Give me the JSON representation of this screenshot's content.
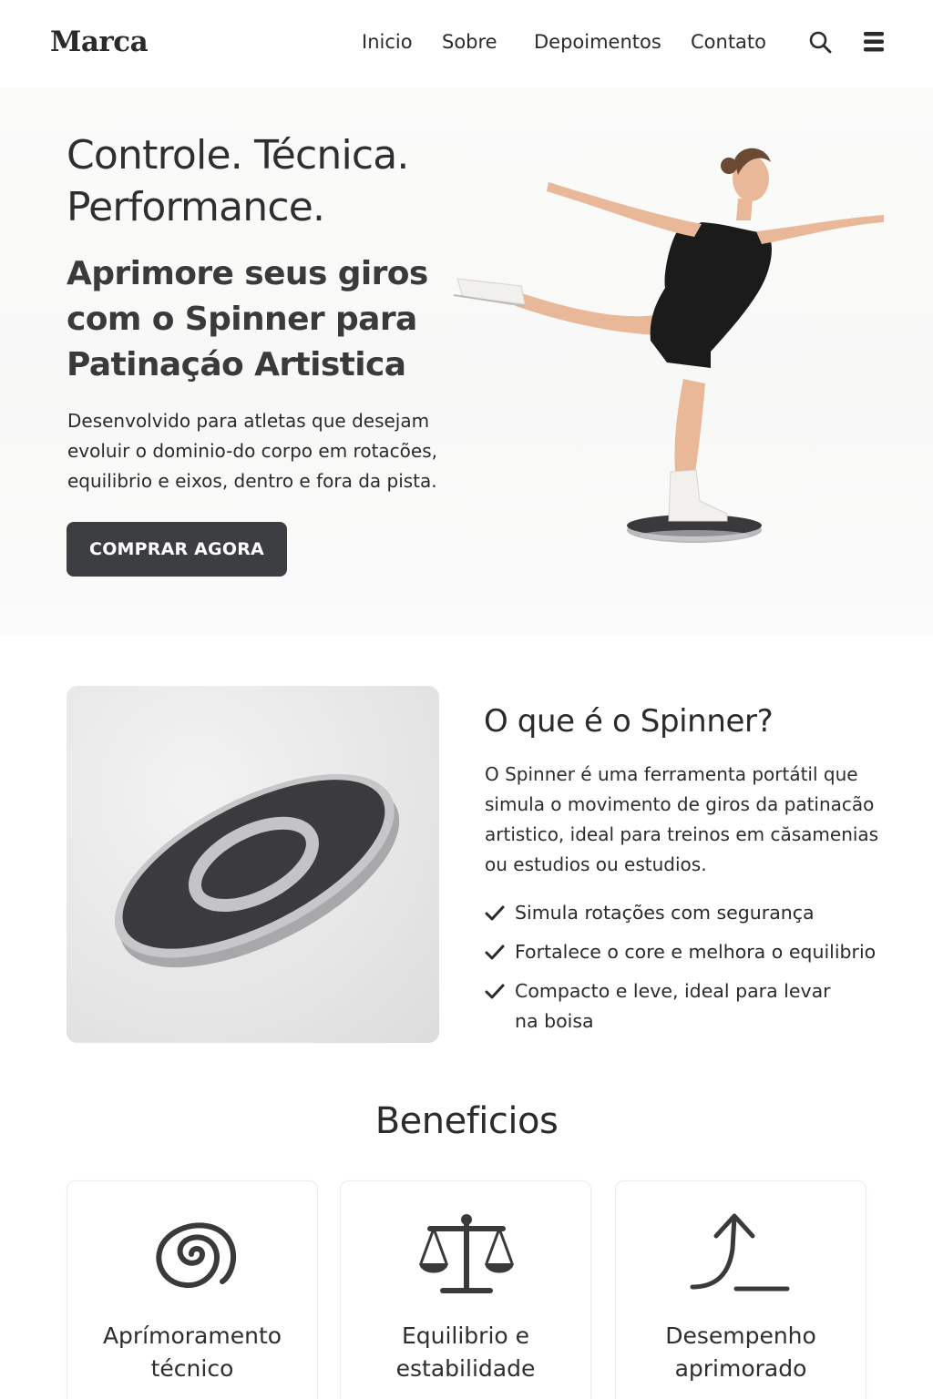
{
  "header": {
    "brand": "Marca",
    "nav": [
      "Inicio",
      "Sobre",
      "Depoimentos",
      "Contato"
    ],
    "search_icon": "search-icon",
    "menu_icon": "hamburger-menu-icon"
  },
  "hero": {
    "title": "Controle. Técnica. Performance.",
    "subtitle": "Aprimore seus giros com o Spinner para Patinaçáo Artistica",
    "description": "Desenvolvido para atletas que desejam evoluir o dominio-do corpo em rotacões, equilibrio e eixos, dentro e fora da pista.",
    "cta": "COMPRAR AGORA"
  },
  "what_is": {
    "title": "O que é o Spinner?",
    "description": "O Spinner é uma ferramenta portátil que simula o movimento de giros da patinacão artistico, ideal para treinos em căsamenias ou estudios ou estudios.",
    "benefits_list": [
      "Simula rotações com segurança",
      "Fortalece o core e melhora o equilibrio",
      "Compacto e leve, ideal para levar na boisa"
    ]
  },
  "benefits": {
    "title": "Beneficios",
    "cards": [
      {
        "label": "Aprímoramento técnico",
        "icon": "spiral-icon"
      },
      {
        "label": "Equilibrio e estabilidade",
        "icon": "scale-balance-icon"
      },
      {
        "label": "Desempenho aprimorado",
        "icon": "arrow-up-curve-icon"
      }
    ]
  },
  "colors": {
    "primary_button": "#3d3e42",
    "text": "#2f2f31",
    "hero_bg": "#f8f8f7",
    "card_border": "#ececec"
  }
}
